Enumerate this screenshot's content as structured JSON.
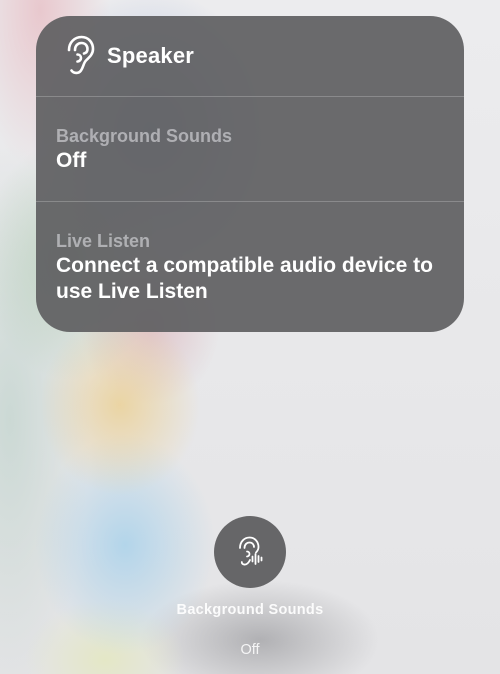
{
  "hearing_panel": {
    "title": "Speaker",
    "header_icon": "ear-icon",
    "background_sounds": {
      "label": "Background Sounds",
      "value": "Off"
    },
    "live_listen": {
      "label": "Live Listen",
      "value": "Connect a compatible audio device to use Live Listen"
    }
  },
  "control_button": {
    "icon": "ear-waveform-icon",
    "label": "Background Sounds",
    "state": "Off"
  }
}
